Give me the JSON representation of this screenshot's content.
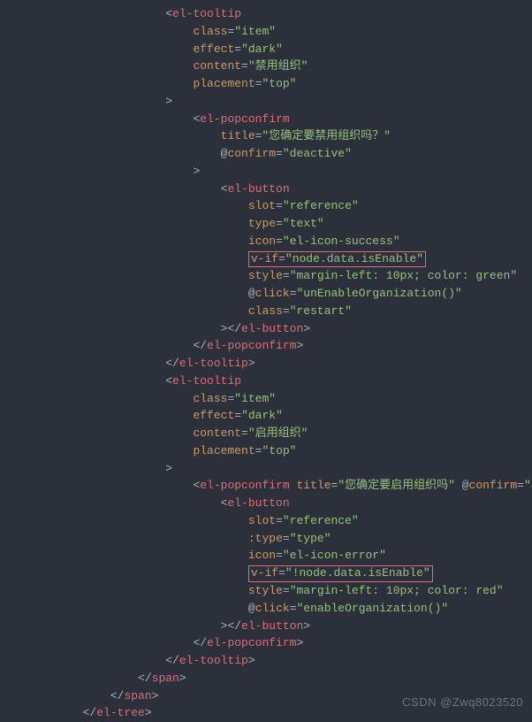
{
  "lines": [
    {
      "indent": 16,
      "segs": [
        {
          "c": "p",
          "t": "<"
        },
        {
          "c": "tag",
          "t": "el-tooltip"
        }
      ]
    },
    {
      "indent": 20,
      "segs": [
        {
          "c": "attr",
          "t": "class"
        },
        {
          "c": "p",
          "t": "="
        },
        {
          "c": "val",
          "t": "\"item\""
        }
      ]
    },
    {
      "indent": 20,
      "segs": [
        {
          "c": "attr",
          "t": "effect"
        },
        {
          "c": "p",
          "t": "="
        },
        {
          "c": "val",
          "t": "\"dark\""
        }
      ]
    },
    {
      "indent": 20,
      "segs": [
        {
          "c": "attr",
          "t": "content"
        },
        {
          "c": "p",
          "t": "="
        },
        {
          "c": "val",
          "t": "\"禁用组织\""
        }
      ]
    },
    {
      "indent": 20,
      "segs": [
        {
          "c": "attr",
          "t": "placement"
        },
        {
          "c": "p",
          "t": "="
        },
        {
          "c": "val",
          "t": "\"top\""
        }
      ]
    },
    {
      "indent": 16,
      "segs": [
        {
          "c": "p",
          "t": ">"
        }
      ]
    },
    {
      "indent": 20,
      "segs": [
        {
          "c": "p",
          "t": "<"
        },
        {
          "c": "tag",
          "t": "el-popconfirm"
        }
      ]
    },
    {
      "indent": 24,
      "segs": [
        {
          "c": "attr",
          "t": "title"
        },
        {
          "c": "p",
          "t": "="
        },
        {
          "c": "val",
          "t": "\"您确定要禁用组织吗？\""
        }
      ]
    },
    {
      "indent": 24,
      "segs": [
        {
          "c": "at",
          "t": "@"
        },
        {
          "c": "attr",
          "t": "confirm"
        },
        {
          "c": "p",
          "t": "="
        },
        {
          "c": "val",
          "t": "\"deactive\""
        }
      ]
    },
    {
      "indent": 20,
      "segs": [
        {
          "c": "p",
          "t": ">"
        }
      ]
    },
    {
      "indent": 24,
      "segs": [
        {
          "c": "p",
          "t": "<"
        },
        {
          "c": "tag",
          "t": "el-button"
        }
      ]
    },
    {
      "indent": 28,
      "segs": [
        {
          "c": "attr",
          "t": "slot"
        },
        {
          "c": "p",
          "t": "="
        },
        {
          "c": "val",
          "t": "\"reference\""
        }
      ]
    },
    {
      "indent": 28,
      "segs": [
        {
          "c": "attr",
          "t": "type"
        },
        {
          "c": "p",
          "t": "="
        },
        {
          "c": "val",
          "t": "\"text\""
        }
      ]
    },
    {
      "indent": 28,
      "segs": [
        {
          "c": "attr",
          "t": "icon"
        },
        {
          "c": "p",
          "t": "="
        },
        {
          "c": "val",
          "t": "\"el-icon-success\""
        }
      ]
    },
    {
      "indent": 28,
      "hl": true,
      "segs": [
        {
          "c": "attr",
          "t": "v-if"
        },
        {
          "c": "p",
          "t": "="
        },
        {
          "c": "val",
          "t": "\"node.data.isEnable\""
        }
      ]
    },
    {
      "indent": 28,
      "segs": [
        {
          "c": "attr",
          "t": "style"
        },
        {
          "c": "p",
          "t": "="
        },
        {
          "c": "val",
          "t": "\"margin-left: 10px; color: green\""
        }
      ]
    },
    {
      "indent": 28,
      "segs": [
        {
          "c": "at",
          "t": "@"
        },
        {
          "c": "attr",
          "t": "click"
        },
        {
          "c": "p",
          "t": "="
        },
        {
          "c": "val",
          "t": "\"unEnableOrganization()\""
        }
      ]
    },
    {
      "indent": 28,
      "segs": [
        {
          "c": "attr",
          "t": "class"
        },
        {
          "c": "p",
          "t": "="
        },
        {
          "c": "val",
          "t": "\"restart\""
        }
      ]
    },
    {
      "indent": 24,
      "segs": [
        {
          "c": "p",
          "t": "></"
        },
        {
          "c": "tag",
          "t": "el-button"
        },
        {
          "c": "p",
          "t": ">"
        }
      ]
    },
    {
      "indent": 20,
      "segs": [
        {
          "c": "p",
          "t": "</"
        },
        {
          "c": "tag",
          "t": "el-popconfirm"
        },
        {
          "c": "p",
          "t": ">"
        }
      ]
    },
    {
      "indent": 16,
      "segs": [
        {
          "c": "p",
          "t": "</"
        },
        {
          "c": "tag",
          "t": "el-tooltip"
        },
        {
          "c": "p",
          "t": ">"
        }
      ]
    },
    {
      "indent": 16,
      "segs": [
        {
          "c": "p",
          "t": "<"
        },
        {
          "c": "tag",
          "t": "el-tooltip"
        }
      ]
    },
    {
      "indent": 20,
      "segs": [
        {
          "c": "attr",
          "t": "class"
        },
        {
          "c": "p",
          "t": "="
        },
        {
          "c": "val",
          "t": "\"item\""
        }
      ]
    },
    {
      "indent": 20,
      "segs": [
        {
          "c": "attr",
          "t": "effect"
        },
        {
          "c": "p",
          "t": "="
        },
        {
          "c": "val",
          "t": "\"dark\""
        }
      ]
    },
    {
      "indent": 20,
      "segs": [
        {
          "c": "attr",
          "t": "content"
        },
        {
          "c": "p",
          "t": "="
        },
        {
          "c": "val",
          "t": "\"启用组织\""
        }
      ]
    },
    {
      "indent": 20,
      "segs": [
        {
          "c": "attr",
          "t": "placement"
        },
        {
          "c": "p",
          "t": "="
        },
        {
          "c": "val",
          "t": "\"top\""
        }
      ]
    },
    {
      "indent": 16,
      "segs": [
        {
          "c": "p",
          "t": ">"
        }
      ]
    },
    {
      "indent": 20,
      "segs": [
        {
          "c": "p",
          "t": "<"
        },
        {
          "c": "tag",
          "t": "el-popconfirm"
        },
        {
          "c": "p",
          "t": " "
        },
        {
          "c": "attr",
          "t": "title"
        },
        {
          "c": "p",
          "t": "="
        },
        {
          "c": "val",
          "t": "\"您确定要启用组织吗\""
        },
        {
          "c": "p",
          "t": " "
        },
        {
          "c": "at",
          "t": "@"
        },
        {
          "c": "attr",
          "t": "confirm"
        },
        {
          "c": "p",
          "t": "="
        },
        {
          "c": "val",
          "t": "\"active\""
        }
      ]
    },
    {
      "indent": 24,
      "segs": [
        {
          "c": "p",
          "t": "<"
        },
        {
          "c": "tag",
          "t": "el-button"
        }
      ]
    },
    {
      "indent": 28,
      "segs": [
        {
          "c": "attr",
          "t": "slot"
        },
        {
          "c": "p",
          "t": "="
        },
        {
          "c": "val",
          "t": "\"reference\""
        }
      ]
    },
    {
      "indent": 28,
      "segs": [
        {
          "c": "attr",
          "t": ":type"
        },
        {
          "c": "p",
          "t": "="
        },
        {
          "c": "val",
          "t": "\"type\""
        }
      ]
    },
    {
      "indent": 28,
      "segs": [
        {
          "c": "attr",
          "t": "icon"
        },
        {
          "c": "p",
          "t": "="
        },
        {
          "c": "val",
          "t": "\"el-icon-error\""
        }
      ]
    },
    {
      "indent": 28,
      "hl": true,
      "segs": [
        {
          "c": "attr",
          "t": "v-if"
        },
        {
          "c": "p",
          "t": "="
        },
        {
          "c": "val",
          "t": "\"!node.data.isEnable\""
        }
      ]
    },
    {
      "indent": 28,
      "segs": [
        {
          "c": "attr",
          "t": "style"
        },
        {
          "c": "p",
          "t": "="
        },
        {
          "c": "val",
          "t": "\"margin-left: 10px; color: red\""
        }
      ]
    },
    {
      "indent": 28,
      "segs": [
        {
          "c": "at",
          "t": "@"
        },
        {
          "c": "attr",
          "t": "click"
        },
        {
          "c": "p",
          "t": "="
        },
        {
          "c": "val",
          "t": "\"enableOrganization()\""
        }
      ]
    },
    {
      "indent": 24,
      "segs": [
        {
          "c": "p",
          "t": "></"
        },
        {
          "c": "tag",
          "t": "el-button"
        },
        {
          "c": "p",
          "t": ">"
        }
      ]
    },
    {
      "indent": 20,
      "segs": [
        {
          "c": "p",
          "t": "</"
        },
        {
          "c": "tag",
          "t": "el-popconfirm"
        },
        {
          "c": "p",
          "t": ">"
        }
      ]
    },
    {
      "indent": 16,
      "segs": [
        {
          "c": "p",
          "t": "</"
        },
        {
          "c": "tag",
          "t": "el-tooltip"
        },
        {
          "c": "p",
          "t": ">"
        }
      ]
    },
    {
      "indent": 12,
      "segs": [
        {
          "c": "p",
          "t": "</"
        },
        {
          "c": "tag",
          "t": "span"
        },
        {
          "c": "p",
          "t": ">"
        }
      ]
    },
    {
      "indent": 8,
      "segs": [
        {
          "c": "p",
          "t": "</"
        },
        {
          "c": "tag",
          "t": "span"
        },
        {
          "c": "p",
          "t": ">"
        }
      ]
    },
    {
      "indent": 4,
      "segs": [
        {
          "c": "p",
          "t": "</"
        },
        {
          "c": "tag",
          "t": "el-tree"
        },
        {
          "c": "p",
          "t": ">"
        }
      ]
    }
  ],
  "watermark": "CSDN @Zwq8023520"
}
